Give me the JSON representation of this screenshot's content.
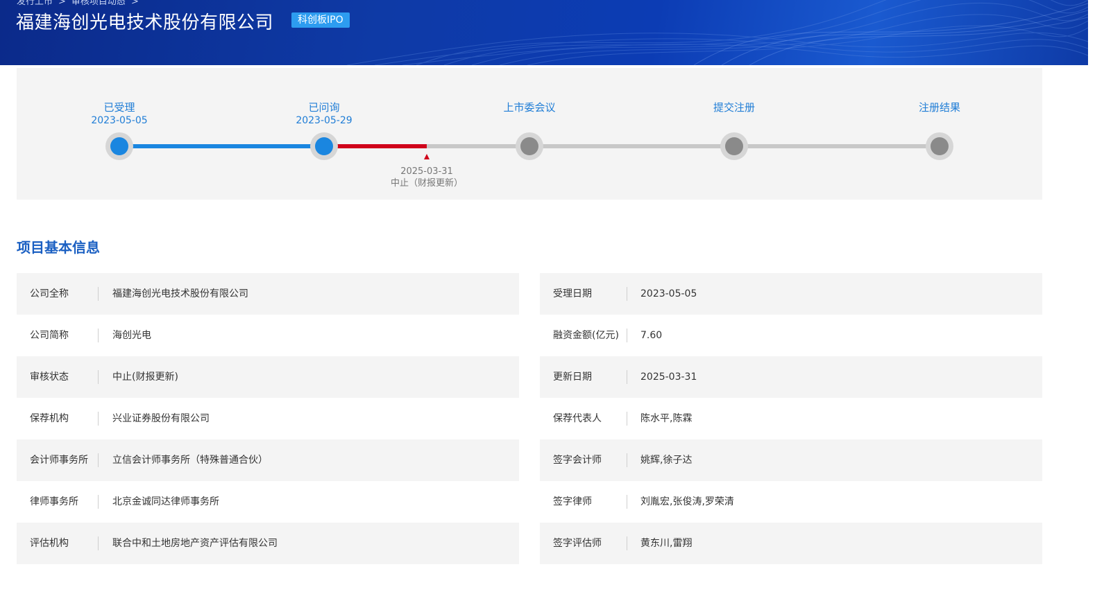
{
  "header": {
    "breadcrumb": [
      "发行上市",
      "审核项目动态"
    ],
    "company_name": "福建海创光电技术股份有限公司",
    "board_badge": "科创板IPO"
  },
  "progress": {
    "steps": [
      {
        "label": "已受理",
        "date": "2023-05-05",
        "status": "done"
      },
      {
        "label": "已问询",
        "date": "2023-05-29",
        "status": "done"
      },
      {
        "label": "上市委会议",
        "date": "",
        "status": "pending"
      },
      {
        "label": "提交注册",
        "date": "",
        "status": "pending"
      },
      {
        "label": "注册结果",
        "date": "",
        "status": "pending"
      }
    ],
    "current_marker": {
      "date": "2025-03-31",
      "text": "中止（财报更新）"
    }
  },
  "section_title": "项目基本信息",
  "info_left": [
    {
      "label": "公司全称",
      "value": "福建海创光电技术股份有限公司"
    },
    {
      "label": "公司简称",
      "value": "海创光电"
    },
    {
      "label": "审核状态",
      "value": "中止(财报更新)"
    },
    {
      "label": "保荐机构",
      "value": "兴业证券股份有限公司"
    },
    {
      "label": "会计师事务所",
      "value": "立信会计师事务所（特殊普通合伙）"
    },
    {
      "label": "律师事务所",
      "value": "北京金诚同达律师事务所"
    },
    {
      "label": "评估机构",
      "value": "联合中和土地房地产资产评估有限公司"
    }
  ],
  "info_right": [
    {
      "label": "受理日期",
      "value": "2023-05-05"
    },
    {
      "label": "融资金额(亿元)",
      "value": "7.60"
    },
    {
      "label": "更新日期",
      "value": "2025-03-31"
    },
    {
      "label": "保荐代表人",
      "value": "陈水平,陈霖"
    },
    {
      "label": "签字会计师",
      "value": "姚辉,徐子达"
    },
    {
      "label": "签字律师",
      "value": "刘胤宏,张俊涛,罗荣清"
    },
    {
      "label": "签字评估师",
      "value": "黄东川,雷翔"
    }
  ],
  "colors": {
    "banner_dark": "#0b2a8a",
    "accent_blue": "#1f7dd6",
    "node_done": "#1a86e0",
    "node_pending": "#8a8a8a",
    "track_done": "#1a86e0",
    "track_current": "#d0021b",
    "track_pending": "#c8c8c8",
    "section_title": "#1a5fc2",
    "badge": "#2d9cf0"
  }
}
